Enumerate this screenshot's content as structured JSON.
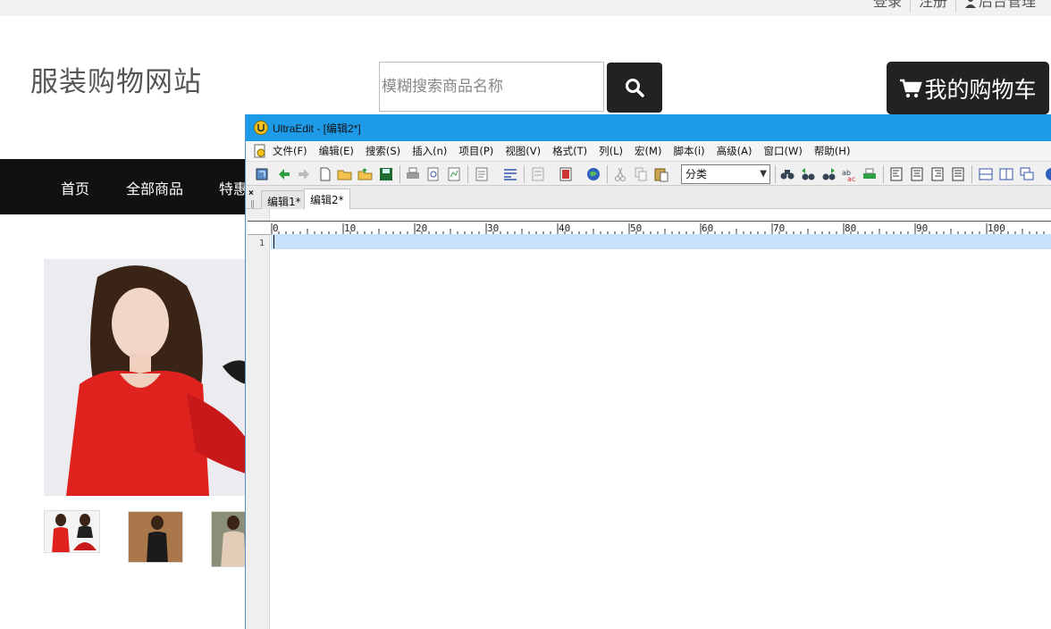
{
  "shop": {
    "top_links": [
      "登录",
      "注册",
      "后台管理"
    ],
    "title": "服装购物网站",
    "search_placeholder": "模糊搜索商品名称",
    "cart_label": "我的购物车",
    "nav": [
      "首页",
      "全部商品",
      "特惠"
    ]
  },
  "editor": {
    "window_title": "UltraEdit - [编辑2*]",
    "menu": [
      "文件(F)",
      "编辑(E)",
      "搜索(S)",
      "插入(n)",
      "项目(P)",
      "视图(V)",
      "格式(T)",
      "列(L)",
      "宏(M)",
      "脚本(i)",
      "高级(A)",
      "窗口(W)",
      "帮助(H)"
    ],
    "category_select": "分类",
    "tabs": [
      "编辑1*",
      "编辑2*"
    ],
    "active_tab": "编辑2*",
    "ruler_labels": [
      "0",
      "10",
      "20",
      "30",
      "40",
      "50",
      "60",
      "70",
      "80",
      "90",
      "100"
    ],
    "line_number": "1"
  },
  "colors": {
    "titlebar": "#1e9be8",
    "navbar": "#111111",
    "current_line": "#c7e2fa"
  }
}
